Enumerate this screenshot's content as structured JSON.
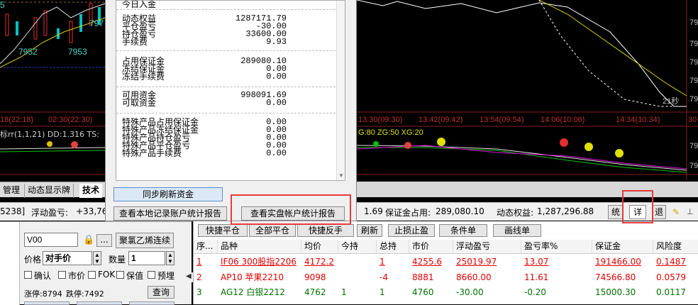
{
  "chart": {
    "price_labels": [
      "5",
      "797",
      "7952",
      "7953"
    ],
    "time_labels": [
      "18(22:18)",
      "02:30(22:30)",
      "13:30(09:30)",
      "13:42(09:42)",
      "13:54(09:54)",
      "14:06(10:06)",
      "14:34(10:34)",
      "30"
    ],
    "countdown": "21秒",
    "right_axis": [
      "79",
      "79",
      "79",
      "79",
      "79",
      "79",
      "79"
    ],
    "indicator_left": "标rr(1,1,21)  DD:1.316  TS:",
    "indicator_right": "G:80  ZG:50  XG:20"
  },
  "popup": {
    "rows_group1": [
      {
        "label": "今日入金",
        "value": ""
      },
      {
        "label": "动态权益",
        "value": "1287171.79"
      },
      {
        "label": "平仓盈亏",
        "value": "-30.00"
      },
      {
        "label": "持仓盈亏",
        "value": "33600.00"
      },
      {
        "label": "手续费",
        "value": "9.93"
      }
    ],
    "rows_group2": [
      {
        "label": "占用保证金",
        "value": "289080.10"
      },
      {
        "label": "冻结保证金",
        "value": "0.00"
      },
      {
        "label": "冻结手续费",
        "value": "0.00"
      }
    ],
    "rows_group3": [
      {
        "label": "可用资金",
        "value": "998091.69"
      },
      {
        "label": "可取资金",
        "value": "0.00"
      }
    ],
    "rows_group4": [
      {
        "label": "特殊产品占用保证金",
        "value": "0.00"
      },
      {
        "label": "特殊产品冻结保证金",
        "value": "0.00"
      },
      {
        "label": "特殊产品持仓盈亏",
        "value": "0.00"
      },
      {
        "label": "特殊产品平仓盈亏",
        "value": "0.00"
      },
      {
        "label": "特殊产品手续费",
        "value": "0.00"
      }
    ],
    "sync_button": "同步刷新资金",
    "local_report_button": "查看本地记录账户统计报告",
    "real_report_button": "查看实盘帐户统计报告"
  },
  "tabs": {
    "t1": "管理",
    "t2": "动态显示牌",
    "t3": "技术"
  },
  "status": {
    "account": "5238]",
    "float_pl_label": "浮动盈亏:",
    "float_pl_value": "+33,76",
    "avail_frag": "1.69",
    "margin_label": "保证金占用:",
    "margin_value": "289,080.10",
    "equity_label": "动态权益:",
    "equity_value": "1,287,296.88",
    "btn_stat": "统",
    "btn_detail": "详",
    "btn_back": "退"
  },
  "order": {
    "contract": "V00",
    "price_label": "价格",
    "price_value": "对手价",
    "qty_label": "数量",
    "qty_value": "1",
    "product_name": "聚氯乙烯连续",
    "dots": "...",
    "checks": [
      "确认",
      "市价",
      "FOK",
      "保值",
      "预埋"
    ],
    "limit_up": "涨停:8794",
    "limit_down": "跌停:7492",
    "query": "查询"
  },
  "toolbar": [
    "快捷平仓",
    "全部平仓",
    "快捷反手",
    "刷新",
    "止损止盈",
    "条件单",
    "画线单"
  ],
  "table": {
    "headers": [
      "序...",
      "品种",
      "均价",
      "今持",
      "总持",
      "市价",
      "浮动盈亏",
      "盈亏率%",
      "保证金",
      "风险度"
    ],
    "rows": [
      {
        "seq": "1",
        "name": "IF06 300股指2206",
        "avg": "4172.2",
        "today": "",
        "total": "1",
        "market": "4255.6",
        "float": "25019.97",
        "rate": "13.07",
        "margin": "191466.00",
        "risk": "0.1487"
      },
      {
        "seq": "2",
        "name": "AP10 苹果2210",
        "avg": "9098",
        "today": "",
        "total": "-4",
        "market": "8881",
        "float": "8660.00",
        "rate": "11.61",
        "margin": "74566.80",
        "risk": "0.0579"
      },
      {
        "seq": "3",
        "name": "AG12 白银2212",
        "avg": "4762",
        "today": "1",
        "total": "1",
        "market": "4760",
        "float": "-30.00",
        "rate": "-0.20",
        "margin": "15000.30",
        "risk": "0.0117"
      }
    ]
  }
}
